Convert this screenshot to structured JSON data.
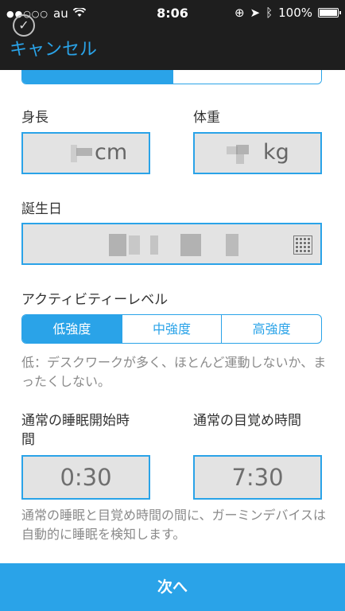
{
  "status_bar": {
    "carrier": "au",
    "time": "8:06",
    "battery": "100%"
  },
  "header": {
    "cancel_label": "キャンセル"
  },
  "fields": {
    "height_label": "身長",
    "height_unit": "cm",
    "weight_label": "体重",
    "weight_unit": "kg",
    "birthday_label": "誕生日"
  },
  "activity": {
    "label": "アクティビティーレベル",
    "options": [
      "低強度",
      "中強度",
      "高強度"
    ],
    "selected": "低強度",
    "note": "低：デスクワークが多く、ほとんど運動しないか、まったくしない。"
  },
  "sleep": {
    "start_label": "通常の睡眠開始時間",
    "start_value": "0:30",
    "wake_label": "通常の目覚め時間",
    "wake_value": "7:30",
    "note": "通常の睡眠と目覚め時間の間に、ガーミンデバイスは自動的に睡眠を検知します。"
  },
  "footer": {
    "next_label": "次へ"
  },
  "colors": {
    "accent": "#2aa3e8",
    "header_bg": "#1e1e1e",
    "field_bg": "#e3e3e3"
  }
}
